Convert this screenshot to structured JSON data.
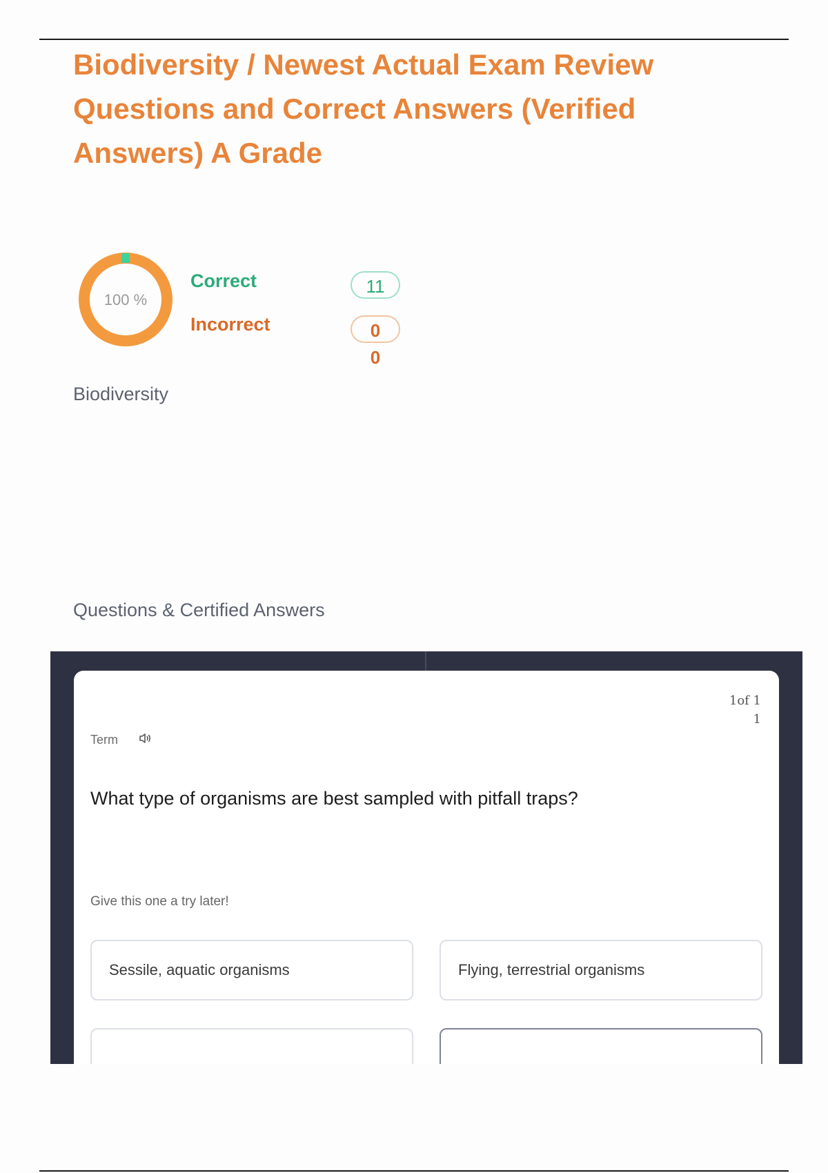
{
  "document": {
    "title": "Biodiversity / Newest Actual Exam Review Questions and Correct Answers (Verified Answers) A Grade"
  },
  "score": {
    "percent_label": "100 %",
    "percent_value": 100,
    "correct_label": "Correct",
    "correct_count": "11",
    "incorrect_label": "Incorrect",
    "incorrect_count": "0",
    "incorrect_count_extra": "0",
    "colors": {
      "ring": "#f39a3e",
      "marker": "#3fd29a",
      "correct": "#2bab7b",
      "incorrect": "#d86a28"
    }
  },
  "subject": "Biodiversity",
  "section_heading": "Questions & Certified Answers",
  "card": {
    "counter_line1": "1of 1",
    "counter_line2": "1",
    "term_label": "Term",
    "audio_icon": "speaker-icon",
    "question": "What type of organisms are best sampled with pitfall traps?",
    "hint": "Give this one a try later!",
    "options": [
      {
        "label": "Sessile, aquatic organisms"
      },
      {
        "label": "Flying, terrestrial organisms"
      },
      {
        "label": ""
      },
      {
        "label": ""
      }
    ]
  }
}
